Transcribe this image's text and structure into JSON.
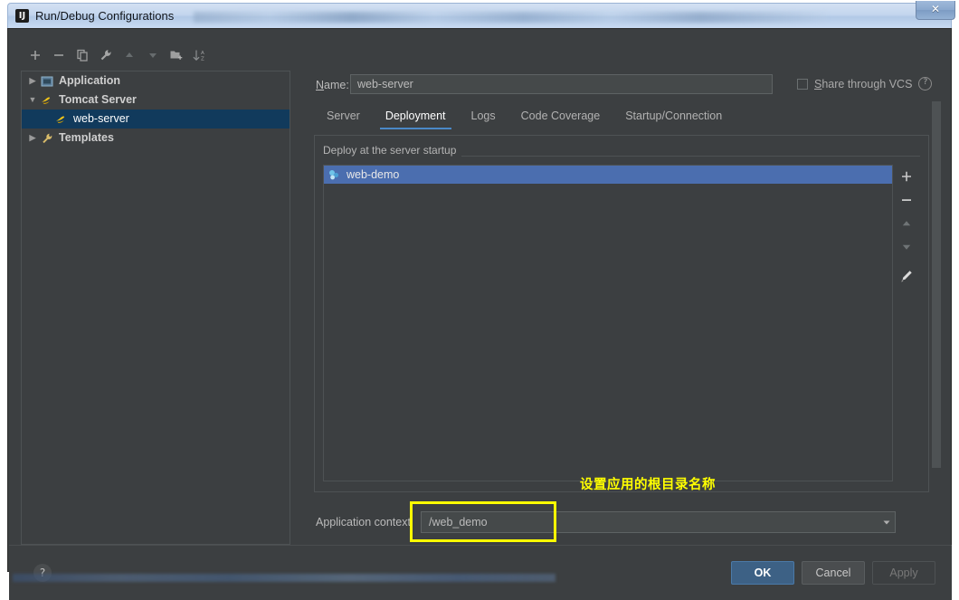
{
  "window": {
    "title": "Run/Debug Configurations",
    "app_icon": "intellij-idea-icon",
    "close_label": "✕"
  },
  "tree_toolbar": {
    "items": [
      {
        "name": "add-configuration-button",
        "icon": "plus-icon"
      },
      {
        "name": "remove-configuration-button",
        "icon": "minus-icon"
      },
      {
        "name": "copy-configuration-button",
        "icon": "copy-icon"
      },
      {
        "name": "edit-defaults-button",
        "icon": "wrench-icon"
      },
      {
        "name": "move-up-button",
        "icon": "arrow-up-icon"
      },
      {
        "name": "move-down-button",
        "icon": "arrow-down-icon"
      },
      {
        "name": "new-folder-button",
        "icon": "folder-add-icon"
      },
      {
        "name": "sort-configurations-button",
        "icon": "sort-az-icon"
      }
    ]
  },
  "tree": {
    "nodes": [
      {
        "label": "Application",
        "icon": "application-icon",
        "twisty": "▶",
        "indent": 0,
        "selected": false,
        "bold": true
      },
      {
        "label": "Tomcat Server",
        "icon": "tomcat-icon",
        "twisty": "▼",
        "indent": 0,
        "selected": false,
        "bold": true
      },
      {
        "label": "web-server",
        "icon": "tomcat-icon",
        "twisty": "",
        "indent": 1,
        "selected": true,
        "bold": false
      },
      {
        "label": "Templates",
        "icon": "wrench-icon",
        "twisty": "▶",
        "indent": 0,
        "selected": false,
        "bold": true
      }
    ]
  },
  "name_field": {
    "label_prefix": "",
    "label_mnemonic": "N",
    "label_suffix": "ame:",
    "value": "web-server"
  },
  "vcs": {
    "checked": false,
    "label_mnemonic": "S",
    "label_prefix": "",
    "label_suffix": "hare through VCS",
    "help_glyph": "?"
  },
  "tabs": [
    {
      "label": "Server",
      "active": false
    },
    {
      "label": "Deployment",
      "active": true
    },
    {
      "label": "Logs",
      "active": false
    },
    {
      "label": "Code Coverage",
      "active": false
    },
    {
      "label": "Startup/Connection",
      "active": false
    }
  ],
  "deployment": {
    "group_label": "Deploy at the server startup",
    "rows": [
      {
        "label": "web-demo",
        "icon": "artifact-icon",
        "selected": true
      }
    ],
    "actions": [
      {
        "name": "add-artifact-button",
        "icon": "plus-icon",
        "glyph": "+"
      },
      {
        "name": "remove-artifact-button",
        "icon": "minus-icon",
        "glyph": "−"
      },
      {
        "name": "move-artifact-up-button",
        "icon": "arrow-up-icon",
        "glyph": "▲"
      },
      {
        "name": "move-artifact-down-button",
        "icon": "arrow-down-icon",
        "glyph": "▼"
      },
      {
        "name": "edit-artifact-button",
        "icon": "pencil-icon",
        "glyph": "✎"
      }
    ]
  },
  "application_context": {
    "label": "Application context",
    "value": "/web_demo",
    "dropdown_glyph": "▼"
  },
  "annotation": {
    "text": "设置应用的根目录名称",
    "color": "#ffff00"
  },
  "footer": {
    "help_glyph": "?",
    "ok_label": "OK",
    "cancel_label": "Cancel",
    "apply_label": "Apply"
  },
  "colors": {
    "dialog_background": "#3c3f41",
    "selection_blue": "#4b6eaf",
    "tree_selection": "#113a5c",
    "tab_underline": "#4a88c7",
    "highlight_yellow": "#ffff00",
    "ok_button": "#3d6185"
  }
}
